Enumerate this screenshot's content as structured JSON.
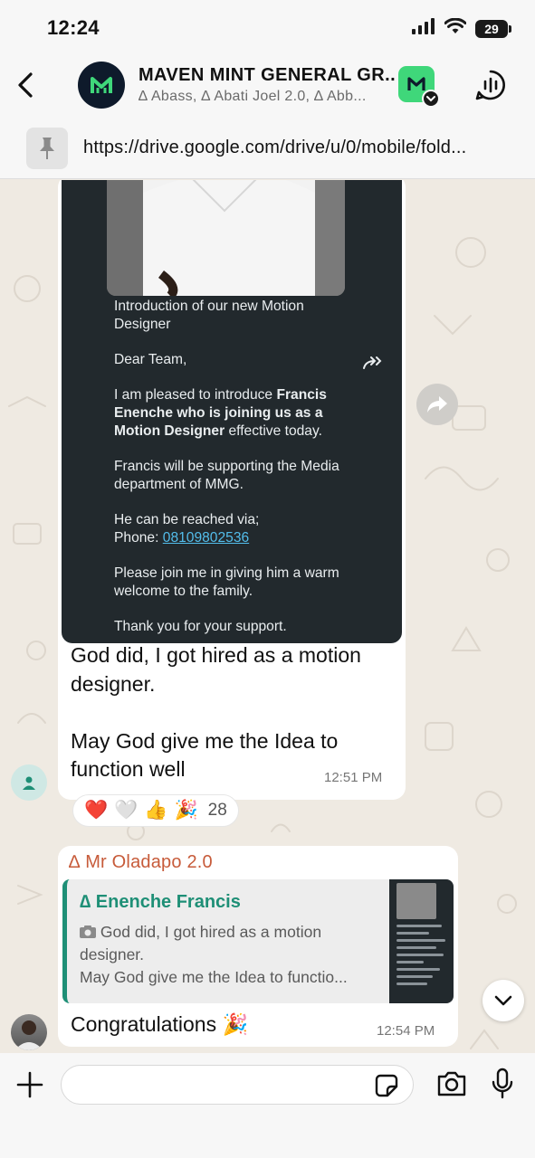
{
  "status": {
    "time": "12:24",
    "battery": "29"
  },
  "header": {
    "title": "MAVEN MINT GENERAL GR...",
    "members": "∆ Abass, ∆ Abati Joel 2.0, ∆ Abb...",
    "avatar_letter": "M"
  },
  "pinned": {
    "text": "https://drive.google.com/drive/u/0/mobile/fold..."
  },
  "message1": {
    "image": {
      "heading": "Introduction of our new Motion Designer",
      "greeting": "Dear Team,",
      "intro_start": "I am pleased to introduce ",
      "intro_bold": "Francis Enenche who is joining us as a Motion Designer",
      "intro_end": " effective today.",
      "support": "Francis will be supporting the Media department of MMG.",
      "reach": "He can be reached via;",
      "phone_label": "Phone: ",
      "phone": "08109802536",
      "welcome": "Please join me in giving him a warm welcome to the family.",
      "thanks": "Thank you for your support."
    },
    "caption_line1": "God did, I got hired as a motion designer.",
    "caption_line2": "May God give me the Idea to function well",
    "time": "12:51 PM",
    "reactions": {
      "emojis": [
        "❤️",
        "🤍",
        "👍",
        "🎉"
      ],
      "count": "28"
    }
  },
  "message2": {
    "sender": "∆ Mr Oladapo 2.0",
    "quote": {
      "name": "∆ Enenche Francis",
      "line1": "God did, I got hired as a motion designer.",
      "line2": "May God give me the Idea to functio..."
    },
    "text": "Congratulations 🎉",
    "time": "12:54 PM"
  },
  "input": {
    "placeholder": ""
  },
  "colors": {
    "sender_name": "#c75b3a",
    "quote_accent": "#1e8f76",
    "community_badge": "#3fd77a",
    "chat_bg": "#efeae2"
  }
}
